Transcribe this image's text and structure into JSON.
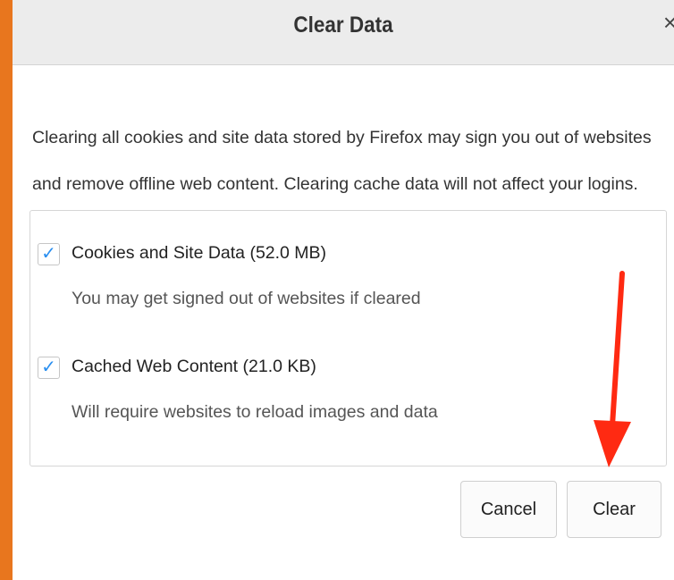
{
  "dialog": {
    "title": "Clear Data",
    "close_glyph": "×",
    "description": "Clearing all cookies and site data stored by Firefox may sign you out of websites and remove offline web content. Clearing cache data will not affect your logins.",
    "options": [
      {
        "label": "Cookies and Site Data (52.0 MB)",
        "description": "You may get signed out of websites if cleared",
        "checked": true
      },
      {
        "label": "Cached Web Content (21.0 KB)",
        "description": "Will require websites to reload images and data",
        "checked": true
      }
    ],
    "cancel_label": "Cancel",
    "clear_label": "Clear"
  },
  "checkmark_glyph": "✓",
  "annotation": {
    "arrow_color": "#ff2a12",
    "arrow_icon": "arrow-down-icon"
  },
  "colors": {
    "frame": "#e8761e",
    "checkmark": "#2a8ff0",
    "titlebar": "#ececec"
  }
}
